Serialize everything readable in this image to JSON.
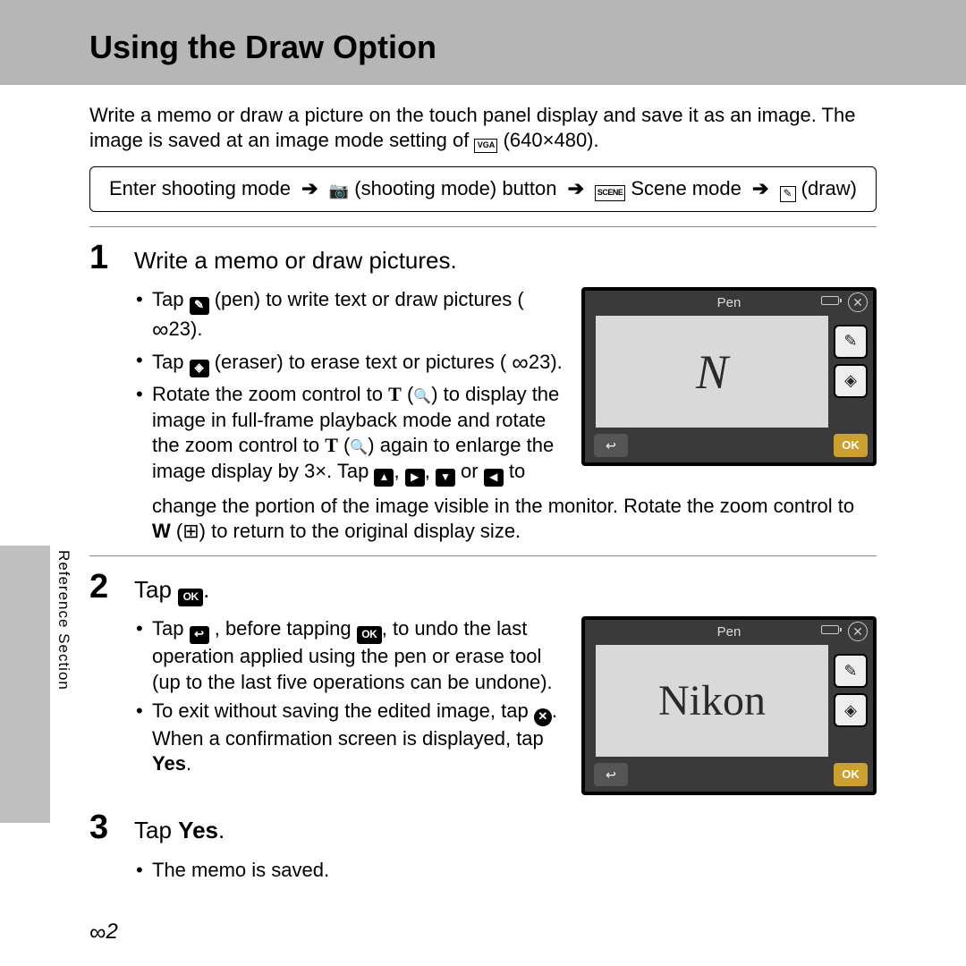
{
  "header": {
    "title": "Using the Draw Option"
  },
  "intro": {
    "text_a": "Write a memo or draw a picture on the touch panel display and save it as an image. The image is saved at an image mode setting of ",
    "vga": "VGA",
    "text_b": " (640×480)."
  },
  "nav": {
    "enter": "Enter shooting mode ",
    "btn": " (shooting mode) button ",
    "scene_label": "SCENE",
    "scene": " Scene mode ",
    "draw": " (draw)"
  },
  "steps": {
    "s1": {
      "num": "1",
      "title": "Write a memo or draw pictures.",
      "b1a": "Tap ",
      "b1b": " (pen) to write text or draw pictures (",
      "b1c": "23).",
      "b2a": "Tap ",
      "b2b": " (eraser) to erase text or pictures (",
      "b2c": "23).",
      "b3a": "Rotate the zoom control to ",
      "b3b": " (",
      "b3c": ") to display the image in full-frame playback mode and rotate the zoom control to ",
      "b3d": " (",
      "b3e": ") again to enlarge the image display by 3×. Tap ",
      "b3f": ", ",
      "b3g": ", ",
      "b3h": " or ",
      "b3i": " to",
      "cont_a": "change the portion of the image visible in the monitor. Rotate the zoom control to ",
      "cont_b": " (",
      "cont_c": ") to return to the original display size."
    },
    "s2": {
      "num": "2",
      "title_a": "Tap ",
      "title_b": ".",
      "b1a": "Tap ",
      "b1b": ", before tapping ",
      "b1c": ", to undo the last operation applied using the pen or erase tool (up to the last five operations can be undone).",
      "b2a": "To exit without saving the edited image, tap ",
      "b2b": ". When a confirmation screen is displayed, tap ",
      "b2c": "Yes",
      "b2d": "."
    },
    "s3": {
      "num": "3",
      "title_a": "Tap ",
      "title_b": "Yes",
      "title_c": ".",
      "b1": "The memo is saved."
    }
  },
  "screens": {
    "title": "Pen",
    "ok": "OK",
    "canvas1": "N",
    "canvas2": "Nikon"
  },
  "sidebar": "Reference Section",
  "pagenum": "2",
  "glyphs": {
    "pen": "✎",
    "eraser": "◈",
    "undo": "⬚",
    "close_x": "✕",
    "back": "↩",
    "mag": "🔍",
    "thumbs": "⊞",
    "up": "▲",
    "right": "▶",
    "down": "▼",
    "left": "◀",
    "camera": "📷",
    "arrow": "➔",
    "OK": "OK",
    "T": "T",
    "W": "W",
    "inf": "∞"
  }
}
